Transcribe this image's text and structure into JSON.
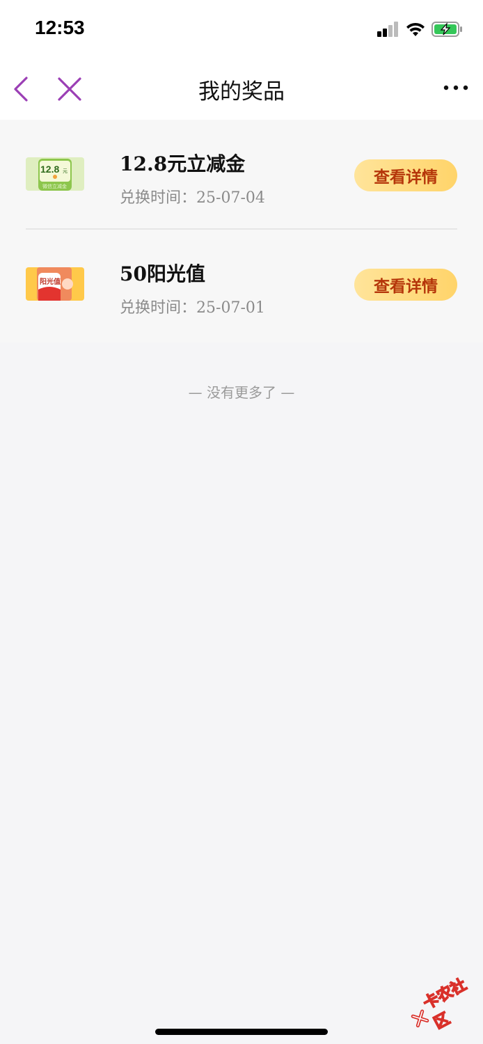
{
  "status_bar": {
    "time": "12:53"
  },
  "nav": {
    "title": "我的奖品"
  },
  "prizes": [
    {
      "name": "12.8元立减金",
      "time_label": "兑换时间：",
      "time_value": "25-07-04",
      "button_label": "查看详情",
      "thumb_text_top": "12.8",
      "thumb_unit": "元",
      "thumb_text_bottom": "微信立减金"
    },
    {
      "name": "50阳光值",
      "time_label": "兑换时间：",
      "time_value": "25-07-01",
      "button_label": "查看详情",
      "thumb_text_top": "阳光值"
    }
  ],
  "footer": {
    "no_more": "— 没有更多了 —"
  },
  "watermark": {
    "text": "卡农社区"
  },
  "colors": {
    "accent": "#9b3fb5",
    "button_text": "#b5360a",
    "button_bg": "#ffd46a"
  }
}
